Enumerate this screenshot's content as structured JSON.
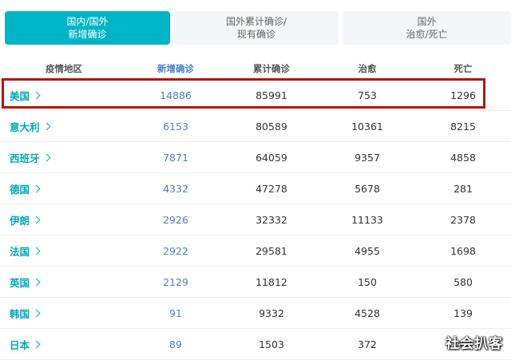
{
  "tabs": [
    {
      "line1": "国内/国外",
      "line2": "新增确诊"
    },
    {
      "line1": "国外累计确诊/",
      "line2": "现有确诊"
    },
    {
      "line1": "国外",
      "line2": "治愈/死亡"
    }
  ],
  "table": {
    "headers": [
      "疫情地区",
      "新增确诊",
      "累计确诊",
      "治愈",
      "死亡"
    ],
    "rows": [
      {
        "region": "美国",
        "new": "14886",
        "total": "85991",
        "cured": "753",
        "dead": "1296"
      },
      {
        "region": "意大利",
        "new": "6153",
        "total": "80589",
        "cured": "10361",
        "dead": "8215"
      },
      {
        "region": "西班牙",
        "new": "7871",
        "total": "64059",
        "cured": "9357",
        "dead": "4858"
      },
      {
        "region": "德国",
        "new": "4332",
        "total": "47278",
        "cured": "5678",
        "dead": "281"
      },
      {
        "region": "伊朗",
        "new": "2926",
        "total": "32332",
        "cured": "11133",
        "dead": "2378"
      },
      {
        "region": "法国",
        "new": "2922",
        "total": "29581",
        "cured": "4955",
        "dead": "1698"
      },
      {
        "region": "英国",
        "new": "2129",
        "total": "11812",
        "cured": "150",
        "dead": "580"
      },
      {
        "region": "韩国",
        "new": "91",
        "total": "9332",
        "cured": "4528",
        "dead": "139"
      },
      {
        "region": "日本",
        "new": "89",
        "total": "1503",
        "cured": "372",
        "dead": "43"
      }
    ]
  },
  "watermark": "社会扒客",
  "colors": {
    "accent": "#00b4c7",
    "highlight": "#b3160b",
    "link": "#4c7fd6"
  }
}
